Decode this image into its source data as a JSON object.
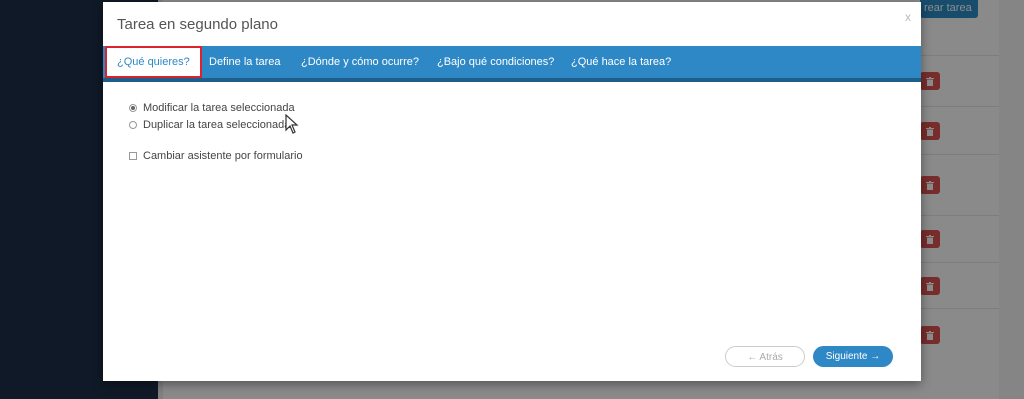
{
  "modal": {
    "title": "Tarea en segundo plano",
    "close_label": "x"
  },
  "tabs": [
    {
      "label": "¿Qué quieres?",
      "active": true
    },
    {
      "label": "Define la tarea"
    },
    {
      "label": "¿Dónde y cómo ocurre?"
    },
    {
      "label": "¿Bajo qué condiciones?"
    },
    {
      "label": "¿Qué hace la tarea?"
    }
  ],
  "options": {
    "radio_modify": {
      "label": "Modificar la tarea seleccionada",
      "checked": true
    },
    "radio_duplicate": {
      "label": "Duplicar la tarea seleccionada",
      "checked": false
    },
    "checkbox_assistant": {
      "label": "Cambiar asistente por formulario",
      "checked": false
    }
  },
  "footer": {
    "back_label": "← Atrás",
    "next_label": "Siguiente →"
  },
  "background": {
    "create_button_label": "rear tarea",
    "trash_icon": "trash-icon"
  },
  "colors": {
    "accent": "#2e88c6",
    "active_tab_border": "#d9232e",
    "danger": "#d9534f",
    "sidebar": "#1e2f47"
  }
}
